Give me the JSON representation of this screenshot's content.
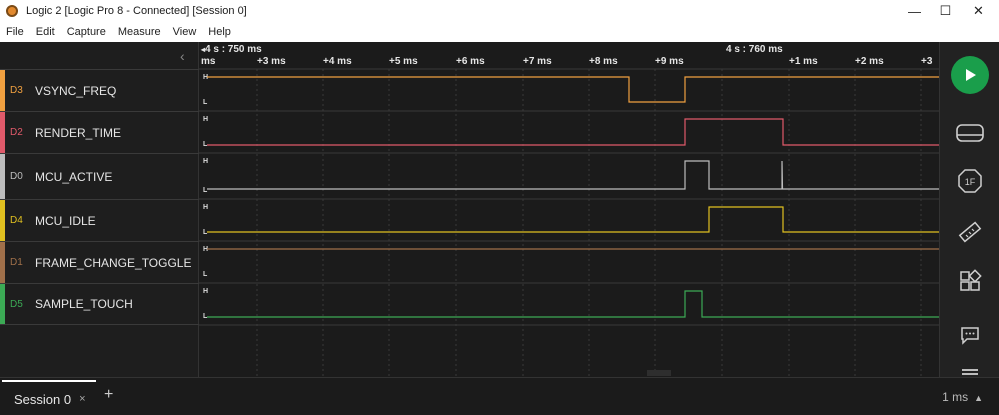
{
  "window": {
    "title": "Logic 2 [Logic Pro 8 - Connected] [Session 0]",
    "minimize_glyph": "—",
    "maximize_glyph": "☐",
    "close_glyph": "✕",
    "app_icon": "logic-gear-icon"
  },
  "menu": [
    "File",
    "Edit",
    "Capture",
    "Measure",
    "View",
    "Help"
  ],
  "timeline": {
    "start_label": "4 s : 750 ms",
    "mid_label": "4 s : 760 ms",
    "unit_label": "ms",
    "ticks": [
      "+3 ms",
      "+4 ms",
      "+5 ms",
      "+6 ms",
      "+7 ms",
      "+8 ms",
      "+9 ms",
      "+1 ms",
      "+2 ms",
      "+3"
    ]
  },
  "channels": [
    {
      "id": "D3",
      "name": "VSYNC_FREQ",
      "color": "#f0a040"
    },
    {
      "id": "D2",
      "name": "RENDER_TIME",
      "color": "#e05a6a"
    },
    {
      "id": "D0",
      "name": "MCU_ACTIVE",
      "color": "#bdbdbd"
    },
    {
      "id": "D4",
      "name": "MCU_IDLE",
      "color": "#e0c020"
    },
    {
      "id": "D1",
      "name": "FRAME_CHANGE_TOGGLE",
      "color": "#a0704a"
    },
    {
      "id": "D5",
      "name": "SAMPLE_TOUCH",
      "color": "#3caa55"
    }
  ],
  "level_labels": {
    "high": "H",
    "low": "L"
  },
  "bottom": {
    "session_tab": "Session 0",
    "close_glyph": "×",
    "add_glyph": "+",
    "zoom": "1 ms",
    "zoom_caret": "▲"
  },
  "sidebar_icons": [
    "play-icon",
    "analyzers-icon",
    "protocol-1f-icon",
    "measure-ruler-icon",
    "extensions-grid-icon",
    "notes-chat-icon",
    "menu-lines-icon"
  ],
  "colors": {
    "accent_green": "#1a9e4b"
  }
}
